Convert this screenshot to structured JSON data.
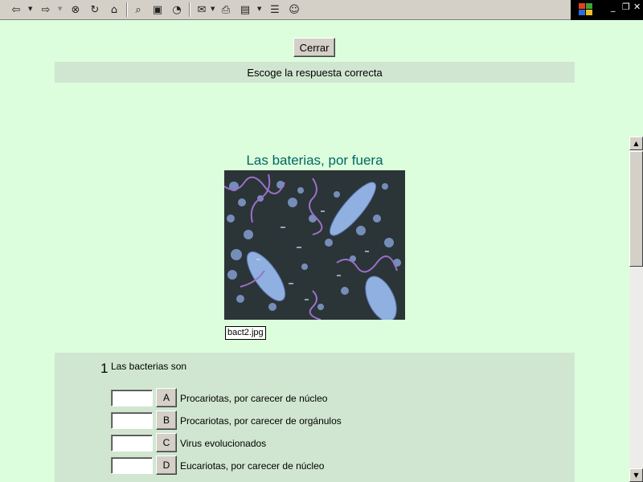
{
  "toolbar": {
    "buttons": [
      {
        "name": "back-icon",
        "glyph": "⇦"
      },
      {
        "name": "forward-icon",
        "glyph": "⇨"
      },
      {
        "name": "stop-icon",
        "glyph": "⊗"
      },
      {
        "name": "refresh-icon",
        "glyph": "↻"
      },
      {
        "name": "home-icon",
        "glyph": "⌂"
      },
      {
        "name": "search-icon",
        "glyph": "⌕"
      },
      {
        "name": "favorites-icon",
        "glyph": "▣"
      },
      {
        "name": "history-icon",
        "glyph": "◔"
      },
      {
        "name": "mail-icon",
        "glyph": "✉"
      },
      {
        "name": "print-icon",
        "glyph": "⎙"
      },
      {
        "name": "edit-icon",
        "glyph": "▤"
      },
      {
        "name": "discuss-icon",
        "glyph": "☰"
      },
      {
        "name": "messenger-icon",
        "glyph": "☺"
      }
    ],
    "window_controls": {
      "minimize": "_",
      "restore": "❐",
      "close": "✕"
    }
  },
  "page": {
    "close_button_label": "Cerrar",
    "instruction": "Escoge la respuesta correcta",
    "section_title": "Las baterias, por fuera",
    "image_caption": "bact2.jpg"
  },
  "question": {
    "number": "1",
    "text": "Las bacterias son",
    "options": [
      {
        "letter": "A",
        "text": "Procariotas, por carecer de núcleo"
      },
      {
        "letter": "B",
        "text": "Procariotas, por carecer de orgánulos"
      },
      {
        "letter": "C",
        "text": "Virus evolucionados"
      },
      {
        "letter": "D",
        "text": "Eucariotas, por carecer de núcleo"
      }
    ]
  },
  "colors": {
    "page_background": "#dcfedc",
    "panel_background": "#d0e6d0",
    "title_color": "#006666"
  }
}
